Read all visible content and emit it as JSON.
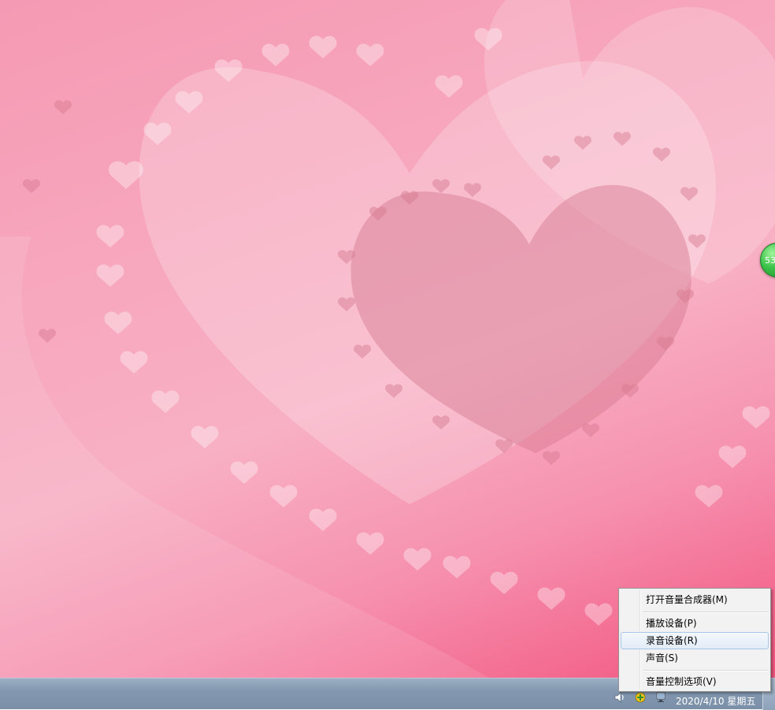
{
  "desktop": {
    "wallpaper": "pink-lace-hearts",
    "widget_bubble_text": "53"
  },
  "context_menu": {
    "items": [
      {
        "label": "打开音量合成器(M)"
      },
      {
        "label": "播放设备(P)"
      },
      {
        "label": "录音设备(R)",
        "highlighted": true
      },
      {
        "label": "声音(S)"
      },
      {
        "label": "音量控制选项(V)"
      }
    ]
  },
  "taskbar": {
    "tray_icons": [
      "speaker-icon",
      "app-tray-icon",
      "network-icon"
    ],
    "clock": "2020/4/10 星期五"
  },
  "colors": {
    "menu_highlight": "#e2ecf7",
    "taskbar": "#8398b0",
    "widget": "#3cc24a"
  }
}
